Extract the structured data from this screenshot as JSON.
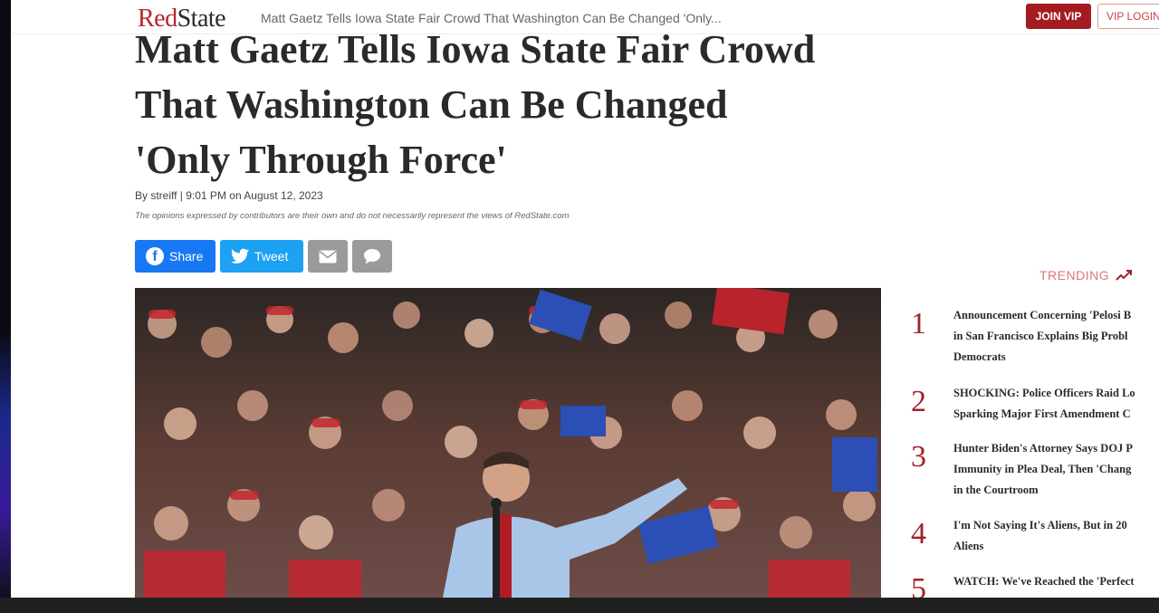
{
  "header": {
    "logo_red": "Red",
    "logo_dark": "State",
    "title": "Matt Gaetz Tells Iowa State Fair Crowd That Washington Can Be Changed 'Only...",
    "join_vip": "JOIN VIP",
    "vip_login": "VIP LOGIN"
  },
  "article": {
    "headline_line1": "Matt Gaetz Tells Iowa State Fair Crowd",
    "headline_line2": "That Washington Can Be Changed",
    "headline_line3": "'Only Through Force'",
    "byline": "By streiff | 9:01 PM on August 12, 2023",
    "disclaimer": "The opinions expressed by contributors are their own and do not necessarily represent the views of RedState.com"
  },
  "share": {
    "facebook": "Share",
    "twitter": "Tweet",
    "email_icon": "envelope-icon",
    "comment_icon": "speech-bubble-icon"
  },
  "trending": {
    "label": "TRENDING",
    "items": [
      {
        "num": "1",
        "line1": "Announcement Concerning 'Pelosi B",
        "line2": "in San Francisco Explains Big Probl",
        "line3": "Democrats"
      },
      {
        "num": "2",
        "line1": "SHOCKING: Police Officers Raid Lo",
        "line2": "Sparking Major First Amendment C"
      },
      {
        "num": "3",
        "line1": "Hunter Biden's Attorney Says DOJ P",
        "line2": "Immunity in Plea Deal, Then 'Chang",
        "line3": "in the Courtroom"
      },
      {
        "num": "4",
        "line1": "I'm Not Saying It's Aliens, But in 20",
        "line2": "Aliens"
      },
      {
        "num": "5",
        "line1": "WATCH: We've Reached the 'Perfect"
      }
    ]
  }
}
